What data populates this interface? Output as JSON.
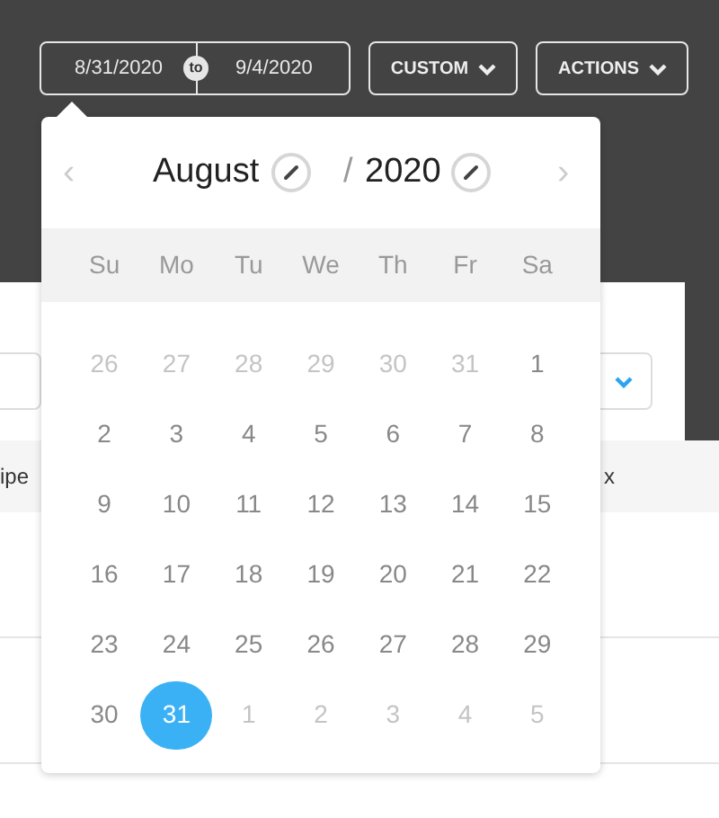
{
  "date_range": {
    "start": "8/31/2020",
    "separator": "to",
    "end": "9/4/2020"
  },
  "buttons": [
    {
      "label": "CUSTOM"
    },
    {
      "label": "ACTIONS"
    }
  ],
  "calendar": {
    "prev": "‹",
    "month": "August",
    "slash": "/",
    "year": "2020",
    "next": "›",
    "weekdays": [
      "Su",
      "Mo",
      "Tu",
      "We",
      "Th",
      "Fr",
      "Sa"
    ],
    "weeks": [
      [
        {
          "day": "26",
          "in_month": false,
          "selected": false
        },
        {
          "day": "27",
          "in_month": false,
          "selected": false
        },
        {
          "day": "28",
          "in_month": false,
          "selected": false
        },
        {
          "day": "29",
          "in_month": false,
          "selected": false
        },
        {
          "day": "30",
          "in_month": false,
          "selected": false
        },
        {
          "day": "31",
          "in_month": false,
          "selected": false
        },
        {
          "day": "1",
          "in_month": true,
          "selected": false
        }
      ],
      [
        {
          "day": "2",
          "in_month": true,
          "selected": false
        },
        {
          "day": "3",
          "in_month": true,
          "selected": false
        },
        {
          "day": "4",
          "in_month": true,
          "selected": false
        },
        {
          "day": "5",
          "in_month": true,
          "selected": false
        },
        {
          "day": "6",
          "in_month": true,
          "selected": false
        },
        {
          "day": "7",
          "in_month": true,
          "selected": false
        },
        {
          "day": "8",
          "in_month": true,
          "selected": false
        }
      ],
      [
        {
          "day": "9",
          "in_month": true,
          "selected": false
        },
        {
          "day": "10",
          "in_month": true,
          "selected": false
        },
        {
          "day": "11",
          "in_month": true,
          "selected": false
        },
        {
          "day": "12",
          "in_month": true,
          "selected": false
        },
        {
          "day": "13",
          "in_month": true,
          "selected": false
        },
        {
          "day": "14",
          "in_month": true,
          "selected": false
        },
        {
          "day": "15",
          "in_month": true,
          "selected": false
        }
      ],
      [
        {
          "day": "16",
          "in_month": true,
          "selected": false
        },
        {
          "day": "17",
          "in_month": true,
          "selected": false
        },
        {
          "day": "18",
          "in_month": true,
          "selected": false
        },
        {
          "day": "19",
          "in_month": true,
          "selected": false
        },
        {
          "day": "20",
          "in_month": true,
          "selected": false
        },
        {
          "day": "21",
          "in_month": true,
          "selected": false
        },
        {
          "day": "22",
          "in_month": true,
          "selected": false
        }
      ],
      [
        {
          "day": "23",
          "in_month": true,
          "selected": false
        },
        {
          "day": "24",
          "in_month": true,
          "selected": false
        },
        {
          "day": "25",
          "in_month": true,
          "selected": false
        },
        {
          "day": "26",
          "in_month": true,
          "selected": false
        },
        {
          "day": "27",
          "in_month": true,
          "selected": false
        },
        {
          "day": "28",
          "in_month": true,
          "selected": false
        },
        {
          "day": "29",
          "in_month": true,
          "selected": false
        }
      ],
      [
        {
          "day": "30",
          "in_month": true,
          "selected": false
        },
        {
          "day": "31",
          "in_month": true,
          "selected": true
        },
        {
          "day": "1",
          "in_month": false,
          "selected": false
        },
        {
          "day": "2",
          "in_month": false,
          "selected": false
        },
        {
          "day": "3",
          "in_month": false,
          "selected": false
        },
        {
          "day": "4",
          "in_month": false,
          "selected": false
        },
        {
          "day": "5",
          "in_month": false,
          "selected": false
        }
      ]
    ]
  },
  "table": {
    "columns": [
      "ipe",
      "x"
    ]
  }
}
